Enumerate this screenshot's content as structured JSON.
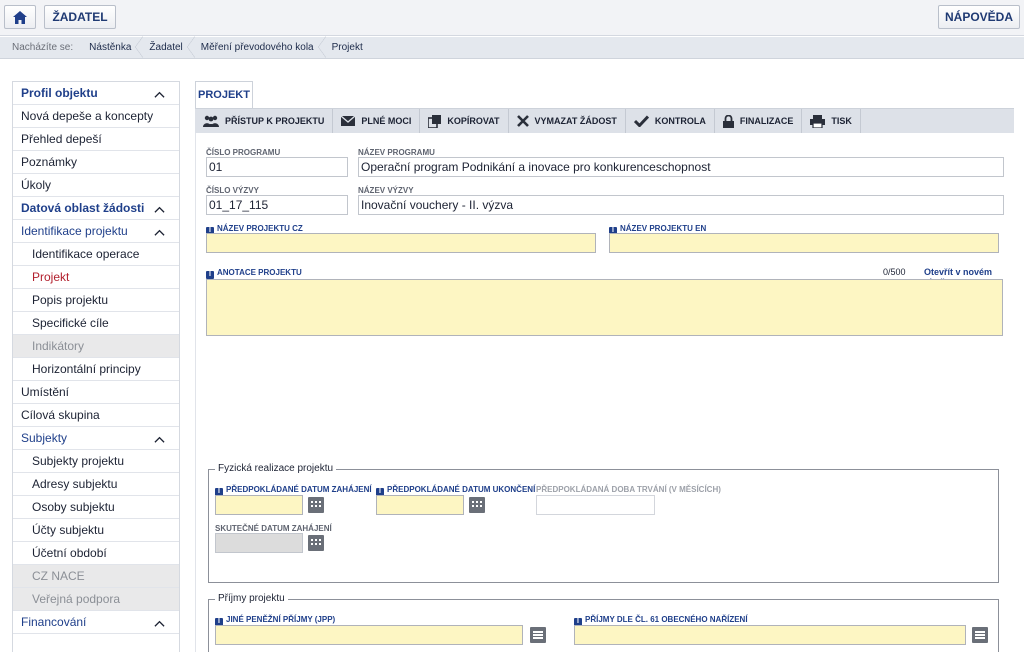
{
  "topbar": {
    "home_icon": "home-icon",
    "zadatel": "ŽADATEL",
    "napoveda": "NÁPOVĚDA"
  },
  "breadcrumb": {
    "lead": "Nacházíte se:",
    "items": [
      "Nástěnka",
      "Žadatel",
      "Měření převodového kola",
      "Projekt"
    ]
  },
  "sidebar": {
    "items": [
      {
        "label": "Profil objektu",
        "style": "head",
        "chevron": true
      },
      {
        "label": "Nová depeše a koncepty",
        "style": "l0"
      },
      {
        "label": "Přehled depeší",
        "style": "l0"
      },
      {
        "label": "Poznámky",
        "style": "l0"
      },
      {
        "label": "Úkoly",
        "style": "l0"
      },
      {
        "label": "Datová oblast žádosti",
        "style": "head",
        "chevron": true
      },
      {
        "label": "Identifikace projektu",
        "style": "group",
        "chevron": true
      },
      {
        "label": "Identifikace operace",
        "style": "l1"
      },
      {
        "label": "Projekt",
        "style": "l1-active"
      },
      {
        "label": "Popis projektu",
        "style": "l1"
      },
      {
        "label": "Specifické cíle",
        "style": "l1"
      },
      {
        "label": "Indikátory",
        "style": "l1-disabled"
      },
      {
        "label": "Horizontální principy",
        "style": "l1"
      },
      {
        "label": "Umístění",
        "style": "l0"
      },
      {
        "label": "Cílová skupina",
        "style": "l0"
      },
      {
        "label": "Subjekty",
        "style": "group",
        "chevron": true
      },
      {
        "label": "Subjekty projektu",
        "style": "l1"
      },
      {
        "label": "Adresy subjektu",
        "style": "l1"
      },
      {
        "label": "Osoby subjektu",
        "style": "l1"
      },
      {
        "label": "Účty subjektu",
        "style": "l1"
      },
      {
        "label": "Účetní období",
        "style": "l1"
      },
      {
        "label": "CZ NACE",
        "style": "l1-disabled"
      },
      {
        "label": "Veřejná podpora",
        "style": "l1-disabled"
      },
      {
        "label": "Financování",
        "style": "group",
        "chevron": true
      }
    ]
  },
  "tab": {
    "label": "PROJEKT"
  },
  "toolbar": [
    {
      "label": "PŘÍSTUP K PROJEKTU",
      "icon": "people-icon"
    },
    {
      "label": "PLNÉ MOCI",
      "icon": "envelope-icon"
    },
    {
      "label": "KOPÍROVAT",
      "icon": "copy-icon"
    },
    {
      "label": "VYMAZAT ŽÁDOST",
      "icon": "delete-icon"
    },
    {
      "label": "KONTROLA",
      "icon": "check-icon"
    },
    {
      "label": "FINALIZACE",
      "icon": "lock-icon"
    },
    {
      "label": "TISK",
      "icon": "print-icon"
    }
  ],
  "form": {
    "cislo_programu_label": "ČÍSLO PROGRAMU",
    "cislo_programu_value": "01",
    "nazev_programu_label": "NÁZEV PROGRAMU",
    "nazev_programu_value": "Operační program Podnikání a inovace pro konkurenceschopnost",
    "cislo_vyzvy_label": "ČÍSLO VÝZVY",
    "cislo_vyzvy_value": "01_17_115",
    "nazev_vyzvy_label": "NÁZEV VÝZVY",
    "nazev_vyzvy_value": "Inovační vouchery - II. výzva",
    "nazev_projektu_cz_label": "NÁZEV PROJEKTU CZ",
    "nazev_projektu_en_label": "NÁZEV PROJEKTU EN",
    "anotace_label": "ANOTACE PROJEKTU",
    "anotace_counter": "0/500",
    "anotace_link": "Otevřít v novém okně",
    "info_glyph": "i"
  },
  "realizace": {
    "legend": "Fyzická realizace projektu",
    "datum_zahajeni_label": "PŘEDPOKLÁDANÉ DATUM ZAHÁJENÍ",
    "datum_ukonceni_label": "PŘEDPOKLÁDANÉ DATUM UKONČENÍ",
    "doba_trvani_label": "PŘEDPOKLÁDANÁ DOBA TRVÁNÍ (V MĚSÍCÍCH)",
    "skutecne_label": "SKUTEČNÉ DATUM ZAHÁJENÍ"
  },
  "prijmy": {
    "legend": "Příjmy projektu",
    "jine_label": "JINÉ PENĚŽNÍ PŘÍJMY (JPP)",
    "cl61_label": "PŘÍJMY DLE ČL. 61 OBECNÉHO NAŘÍZENÍ"
  }
}
